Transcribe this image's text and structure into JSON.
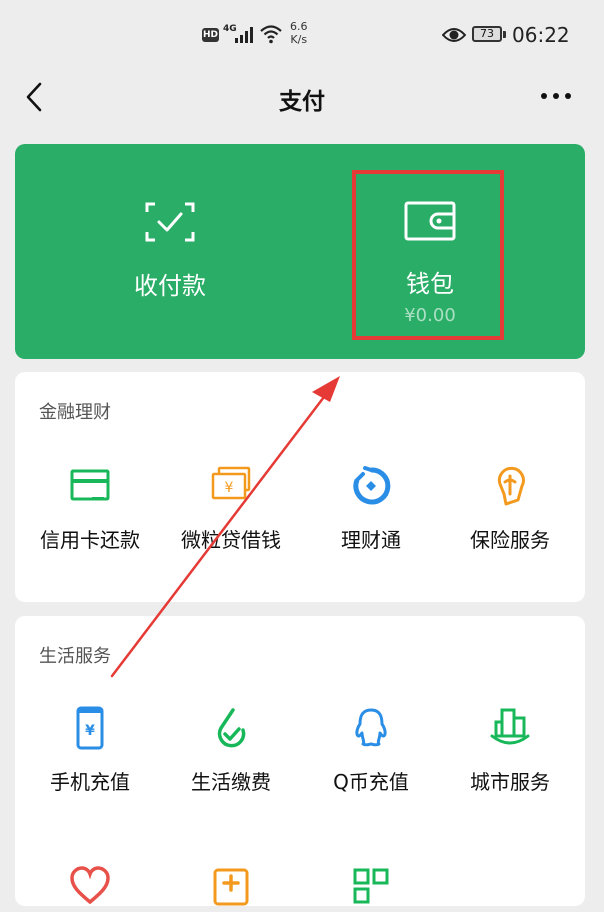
{
  "status_bar": {
    "hd": "HD",
    "network": "4G",
    "speed_value": "6.6",
    "speed_unit": "K/s",
    "battery": "73",
    "time": "06:22"
  },
  "nav": {
    "title": "支付",
    "back_icon": "chevron-left-icon",
    "more_icon": "more-horizontal-icon"
  },
  "top_panel": {
    "background": "#2aae67",
    "items": [
      {
        "label": "收付款",
        "icon": "scan-check-icon"
      },
      {
        "label": "钱包",
        "sub": "¥0.00",
        "icon": "wallet-icon"
      }
    ]
  },
  "finance": {
    "title": "金融理财",
    "items": [
      {
        "label": "信用卡还款",
        "icon": "credit-card-icon",
        "color": "#18b85a"
      },
      {
        "label": "微粒贷借钱",
        "icon": "yuan-bill-icon",
        "color": "#f39a1e"
      },
      {
        "label": "理财通",
        "icon": "licaitong-icon",
        "color": "#2a8ee6"
      },
      {
        "label": "保险服务",
        "icon": "insurance-umbrella-icon",
        "color": "#f39a1e"
      }
    ]
  },
  "life": {
    "title": "生活服务",
    "items": [
      {
        "label": "手机充值",
        "icon": "phone-recharge-icon",
        "color": "#2a8ee6"
      },
      {
        "label": "生活缴费",
        "icon": "utility-payment-icon",
        "color": "#18b85a"
      },
      {
        "label": "Q币充值",
        "icon": "qq-coin-icon",
        "color": "#2a8ee6"
      },
      {
        "label": "城市服务",
        "icon": "city-service-icon",
        "color": "#18b85a"
      }
    ]
  },
  "annotation": {
    "box_color": "#e53a35",
    "arrow_color": "#e53a35"
  }
}
